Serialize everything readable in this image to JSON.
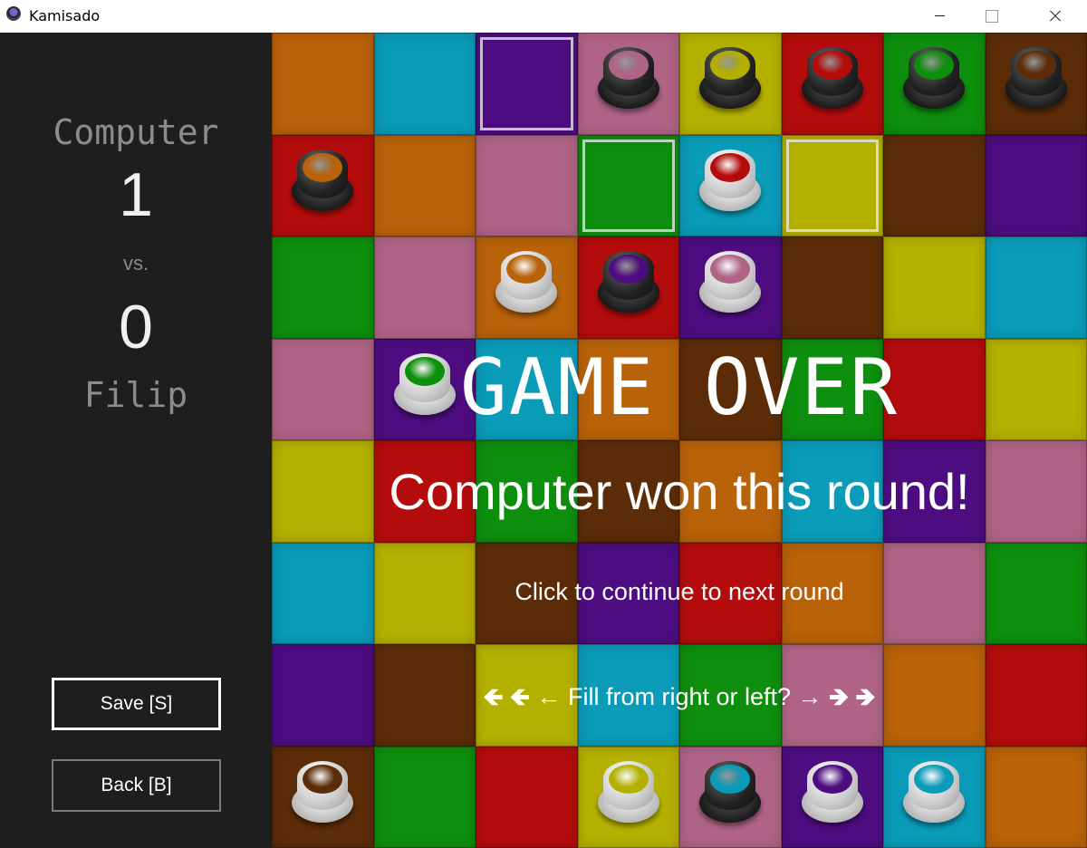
{
  "window": {
    "title": "Kamisado"
  },
  "sidebar": {
    "player1_name": "Computer",
    "player1_score": "1",
    "vs_label": "vs.",
    "player2_score": "0",
    "player2_name": "Filip",
    "save_label": "Save [S]",
    "back_label": "Back [B]"
  },
  "overlay": {
    "title": "GAME OVER",
    "winner_text": "Computer won this round!",
    "continue_text": "Click to continue to next round",
    "fill_text": "Fill from right or left?",
    "arrows_left": [
      "🡸",
      "🡸",
      "←"
    ],
    "arrows_right": [
      "→",
      "🡺",
      "🡺"
    ]
  },
  "colors": {
    "orange": "#b8620a",
    "blue": "#0a9bb8",
    "purple": "#4d0d80",
    "pink": "#b06485",
    "yellow": "#b4b000",
    "red": "#b40c0c",
    "green": "#0d8e0d",
    "brown": "#5c2c08"
  },
  "board": {
    "rows": [
      [
        "orange",
        "blue",
        "purple",
        "pink",
        "yellow",
        "red",
        "green",
        "brown"
      ],
      [
        "red",
        "orange",
        "pink",
        "green",
        "blue",
        "yellow",
        "brown",
        "purple"
      ],
      [
        "green",
        "pink",
        "orange",
        "red",
        "purple",
        "brown",
        "yellow",
        "blue"
      ],
      [
        "pink",
        "purple",
        "blue",
        "orange",
        "brown",
        "green",
        "red",
        "yellow"
      ],
      [
        "yellow",
        "red",
        "green",
        "brown",
        "orange",
        "blue",
        "purple",
        "pink"
      ],
      [
        "blue",
        "yellow",
        "brown",
        "purple",
        "red",
        "orange",
        "pink",
        "green"
      ],
      [
        "purple",
        "brown",
        "yellow",
        "blue",
        "green",
        "pink",
        "orange",
        "red"
      ],
      [
        "brown",
        "green",
        "red",
        "yellow",
        "pink",
        "purple",
        "blue",
        "orange"
      ]
    ],
    "highlights": [
      [
        0,
        2
      ],
      [
        1,
        3
      ],
      [
        1,
        5
      ]
    ],
    "pieces": [
      {
        "row": 0,
        "col": 3,
        "player": "black",
        "color": "pink"
      },
      {
        "row": 0,
        "col": 4,
        "player": "black",
        "color": "yellow"
      },
      {
        "row": 0,
        "col": 5,
        "player": "black",
        "color": "red"
      },
      {
        "row": 0,
        "col": 6,
        "player": "black",
        "color": "green"
      },
      {
        "row": 0,
        "col": 7,
        "player": "black",
        "color": "brown"
      },
      {
        "row": 1,
        "col": 0,
        "player": "black",
        "color": "orange"
      },
      {
        "row": 1,
        "col": 4,
        "player": "white",
        "color": "red"
      },
      {
        "row": 2,
        "col": 2,
        "player": "white",
        "color": "orange"
      },
      {
        "row": 2,
        "col": 3,
        "player": "black",
        "color": "purple"
      },
      {
        "row": 2,
        "col": 4,
        "player": "white",
        "color": "pink"
      },
      {
        "row": 3,
        "col": 1,
        "player": "white",
        "color": "green"
      },
      {
        "row": 7,
        "col": 0,
        "player": "white",
        "color": "brown"
      },
      {
        "row": 7,
        "col": 3,
        "player": "white",
        "color": "yellow"
      },
      {
        "row": 7,
        "col": 4,
        "player": "black",
        "color": "blue"
      },
      {
        "row": 7,
        "col": 5,
        "player": "white",
        "color": "purple"
      },
      {
        "row": 7,
        "col": 6,
        "player": "white",
        "color": "blue"
      }
    ]
  }
}
